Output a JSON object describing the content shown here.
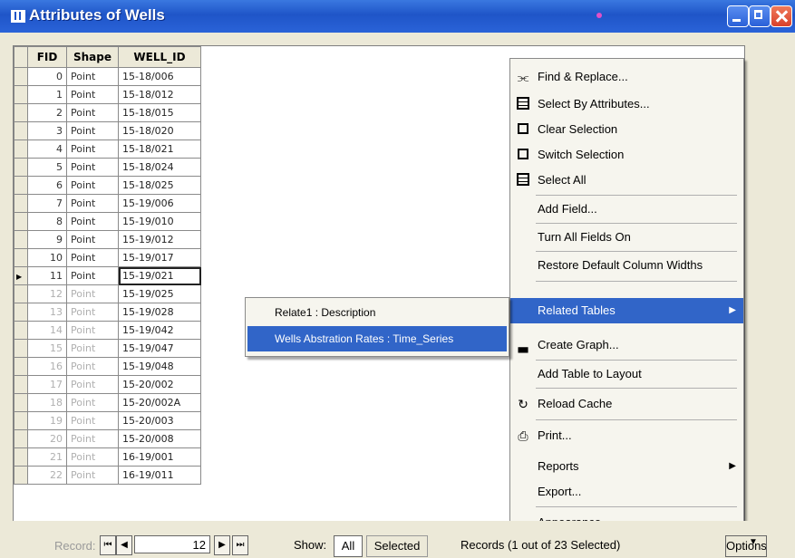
{
  "window": {
    "title": "Attributes of Wells"
  },
  "table": {
    "columns": [
      "FID",
      "Shape",
      "WELL_ID"
    ],
    "rows": [
      {
        "fid": "0",
        "shape": "Point",
        "well": "15-18/006"
      },
      {
        "fid": "1",
        "shape": "Point",
        "well": "15-18/012"
      },
      {
        "fid": "2",
        "shape": "Point",
        "well": "15-18/015"
      },
      {
        "fid": "3",
        "shape": "Point",
        "well": "15-18/020"
      },
      {
        "fid": "4",
        "shape": "Point",
        "well": "15-18/021"
      },
      {
        "fid": "5",
        "shape": "Point",
        "well": "15-18/024"
      },
      {
        "fid": "6",
        "shape": "Point",
        "well": "15-18/025"
      },
      {
        "fid": "7",
        "shape": "Point",
        "well": "15-19/006"
      },
      {
        "fid": "8",
        "shape": "Point",
        "well": "15-19/010"
      },
      {
        "fid": "9",
        "shape": "Point",
        "well": "15-19/012"
      },
      {
        "fid": "10",
        "shape": "Point",
        "well": "15-19/017"
      },
      {
        "fid": "11",
        "shape": "Point",
        "well": "15-19/021"
      },
      {
        "fid": "12",
        "shape": "Point",
        "well": "15-19/025"
      },
      {
        "fid": "13",
        "shape": "Point",
        "well": "15-19/028"
      },
      {
        "fid": "14",
        "shape": "Point",
        "well": "15-19/042"
      },
      {
        "fid": "15",
        "shape": "Point",
        "well": "15-19/047"
      },
      {
        "fid": "16",
        "shape": "Point",
        "well": "15-19/048"
      },
      {
        "fid": "17",
        "shape": "Point",
        "well": "15-20/002"
      },
      {
        "fid": "18",
        "shape": "Point",
        "well": "15-20/002A"
      },
      {
        "fid": "19",
        "shape": "Point",
        "well": "15-20/003"
      },
      {
        "fid": "20",
        "shape": "Point",
        "well": "15-20/008"
      },
      {
        "fid": "21",
        "shape": "Point",
        "well": "16-19/001"
      },
      {
        "fid": "22",
        "shape": "Point",
        "well": "16-19/011"
      }
    ],
    "current_row_index": 11
  },
  "menu": {
    "items": [
      {
        "label": "Find & Replace...",
        "icon": "binoculars-icon"
      },
      {
        "label": "Select By Attributes...",
        "icon": "select-by-attributes-icon"
      },
      {
        "label": "Clear Selection",
        "icon": "clear-selection-icon"
      },
      {
        "label": "Switch Selection",
        "icon": "switch-selection-icon"
      },
      {
        "label": "Select All",
        "icon": "select-all-icon"
      },
      {
        "label": "Add Field..."
      },
      {
        "label": "Turn All Fields On"
      },
      {
        "label": "Restore Default Column Widths"
      },
      {
        "label": "Related Tables",
        "highlighted": true,
        "submenu": true
      },
      {
        "label": "Create Graph...",
        "icon": "graph-icon"
      },
      {
        "label": "Add Table to Layout"
      },
      {
        "label": "Reload Cache",
        "icon": "reload-icon"
      },
      {
        "label": "Print...",
        "icon": "printer-icon"
      },
      {
        "label": "Reports",
        "submenu": true
      },
      {
        "label": "Export..."
      },
      {
        "label": "Appearance..."
      }
    ]
  },
  "submenu": {
    "items": [
      {
        "label": "Relate1 : Description"
      },
      {
        "label": "Wells Abstration Rates : Time_Series",
        "highlighted": true
      }
    ]
  },
  "bottom": {
    "record_label": "Record:",
    "record_value": "12",
    "show_label": "Show:",
    "all_label": "All",
    "selected_label": "Selected",
    "records_text": "Records (1 out of 23 Selected)",
    "options_label": "Options"
  }
}
